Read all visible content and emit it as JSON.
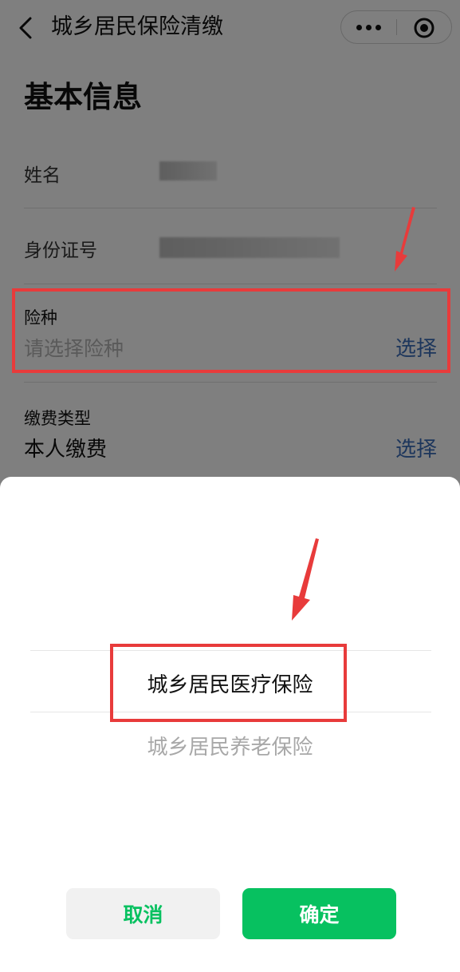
{
  "nav": {
    "title": "城乡居民保险清缴"
  },
  "section": {
    "title": "基本信息"
  },
  "fields": {
    "name_label": "姓名",
    "id_label": "身份证号",
    "insurance": {
      "label": "险种",
      "placeholder": "请选择险种",
      "action": "选择"
    },
    "payment": {
      "label": "缴费类型",
      "value": "本人缴费",
      "action": "选择"
    }
  },
  "picker": {
    "options": [
      "城乡居民医疗保险",
      "城乡居民养老保险"
    ],
    "selected_index": 0,
    "cancel_label": "取消",
    "confirm_label": "确定"
  },
  "colors": {
    "accent_green": "#07c160",
    "link_blue": "#3b6db8",
    "annotation_red": "#e83b3b"
  }
}
